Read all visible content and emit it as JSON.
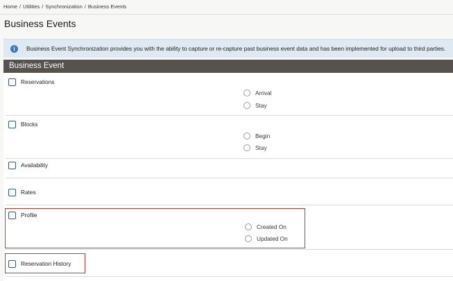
{
  "breadcrumb": [
    "Home",
    "Utilities",
    "Synchronization",
    "Business Events"
  ],
  "page": {
    "title": "Business Events"
  },
  "info": {
    "message": "Business Event Synchronization provides you with the ability to capture or re-capture past business event data and has been implemented for upload to third parties."
  },
  "section": {
    "title": "Business Event"
  },
  "events": {
    "reservations": {
      "label": "Reservations",
      "options": [
        "Arrival",
        "Stay"
      ]
    },
    "blocks": {
      "label": "Blocks",
      "options": [
        "Begin",
        "Stay"
      ]
    },
    "availability": {
      "label": "Availability"
    },
    "rates": {
      "label": "Rates"
    },
    "profile": {
      "label": "Profile",
      "options": [
        "Created On",
        "Updated On"
      ]
    },
    "reservation_history": {
      "label": "Reservation History"
    }
  },
  "colors": {
    "header_bg": "#55524f",
    "info_bg": "#dfe9f1",
    "info_icon": "#3b78c4",
    "checkbox_border": "#2c5a78",
    "highlight": "#d9302c"
  }
}
